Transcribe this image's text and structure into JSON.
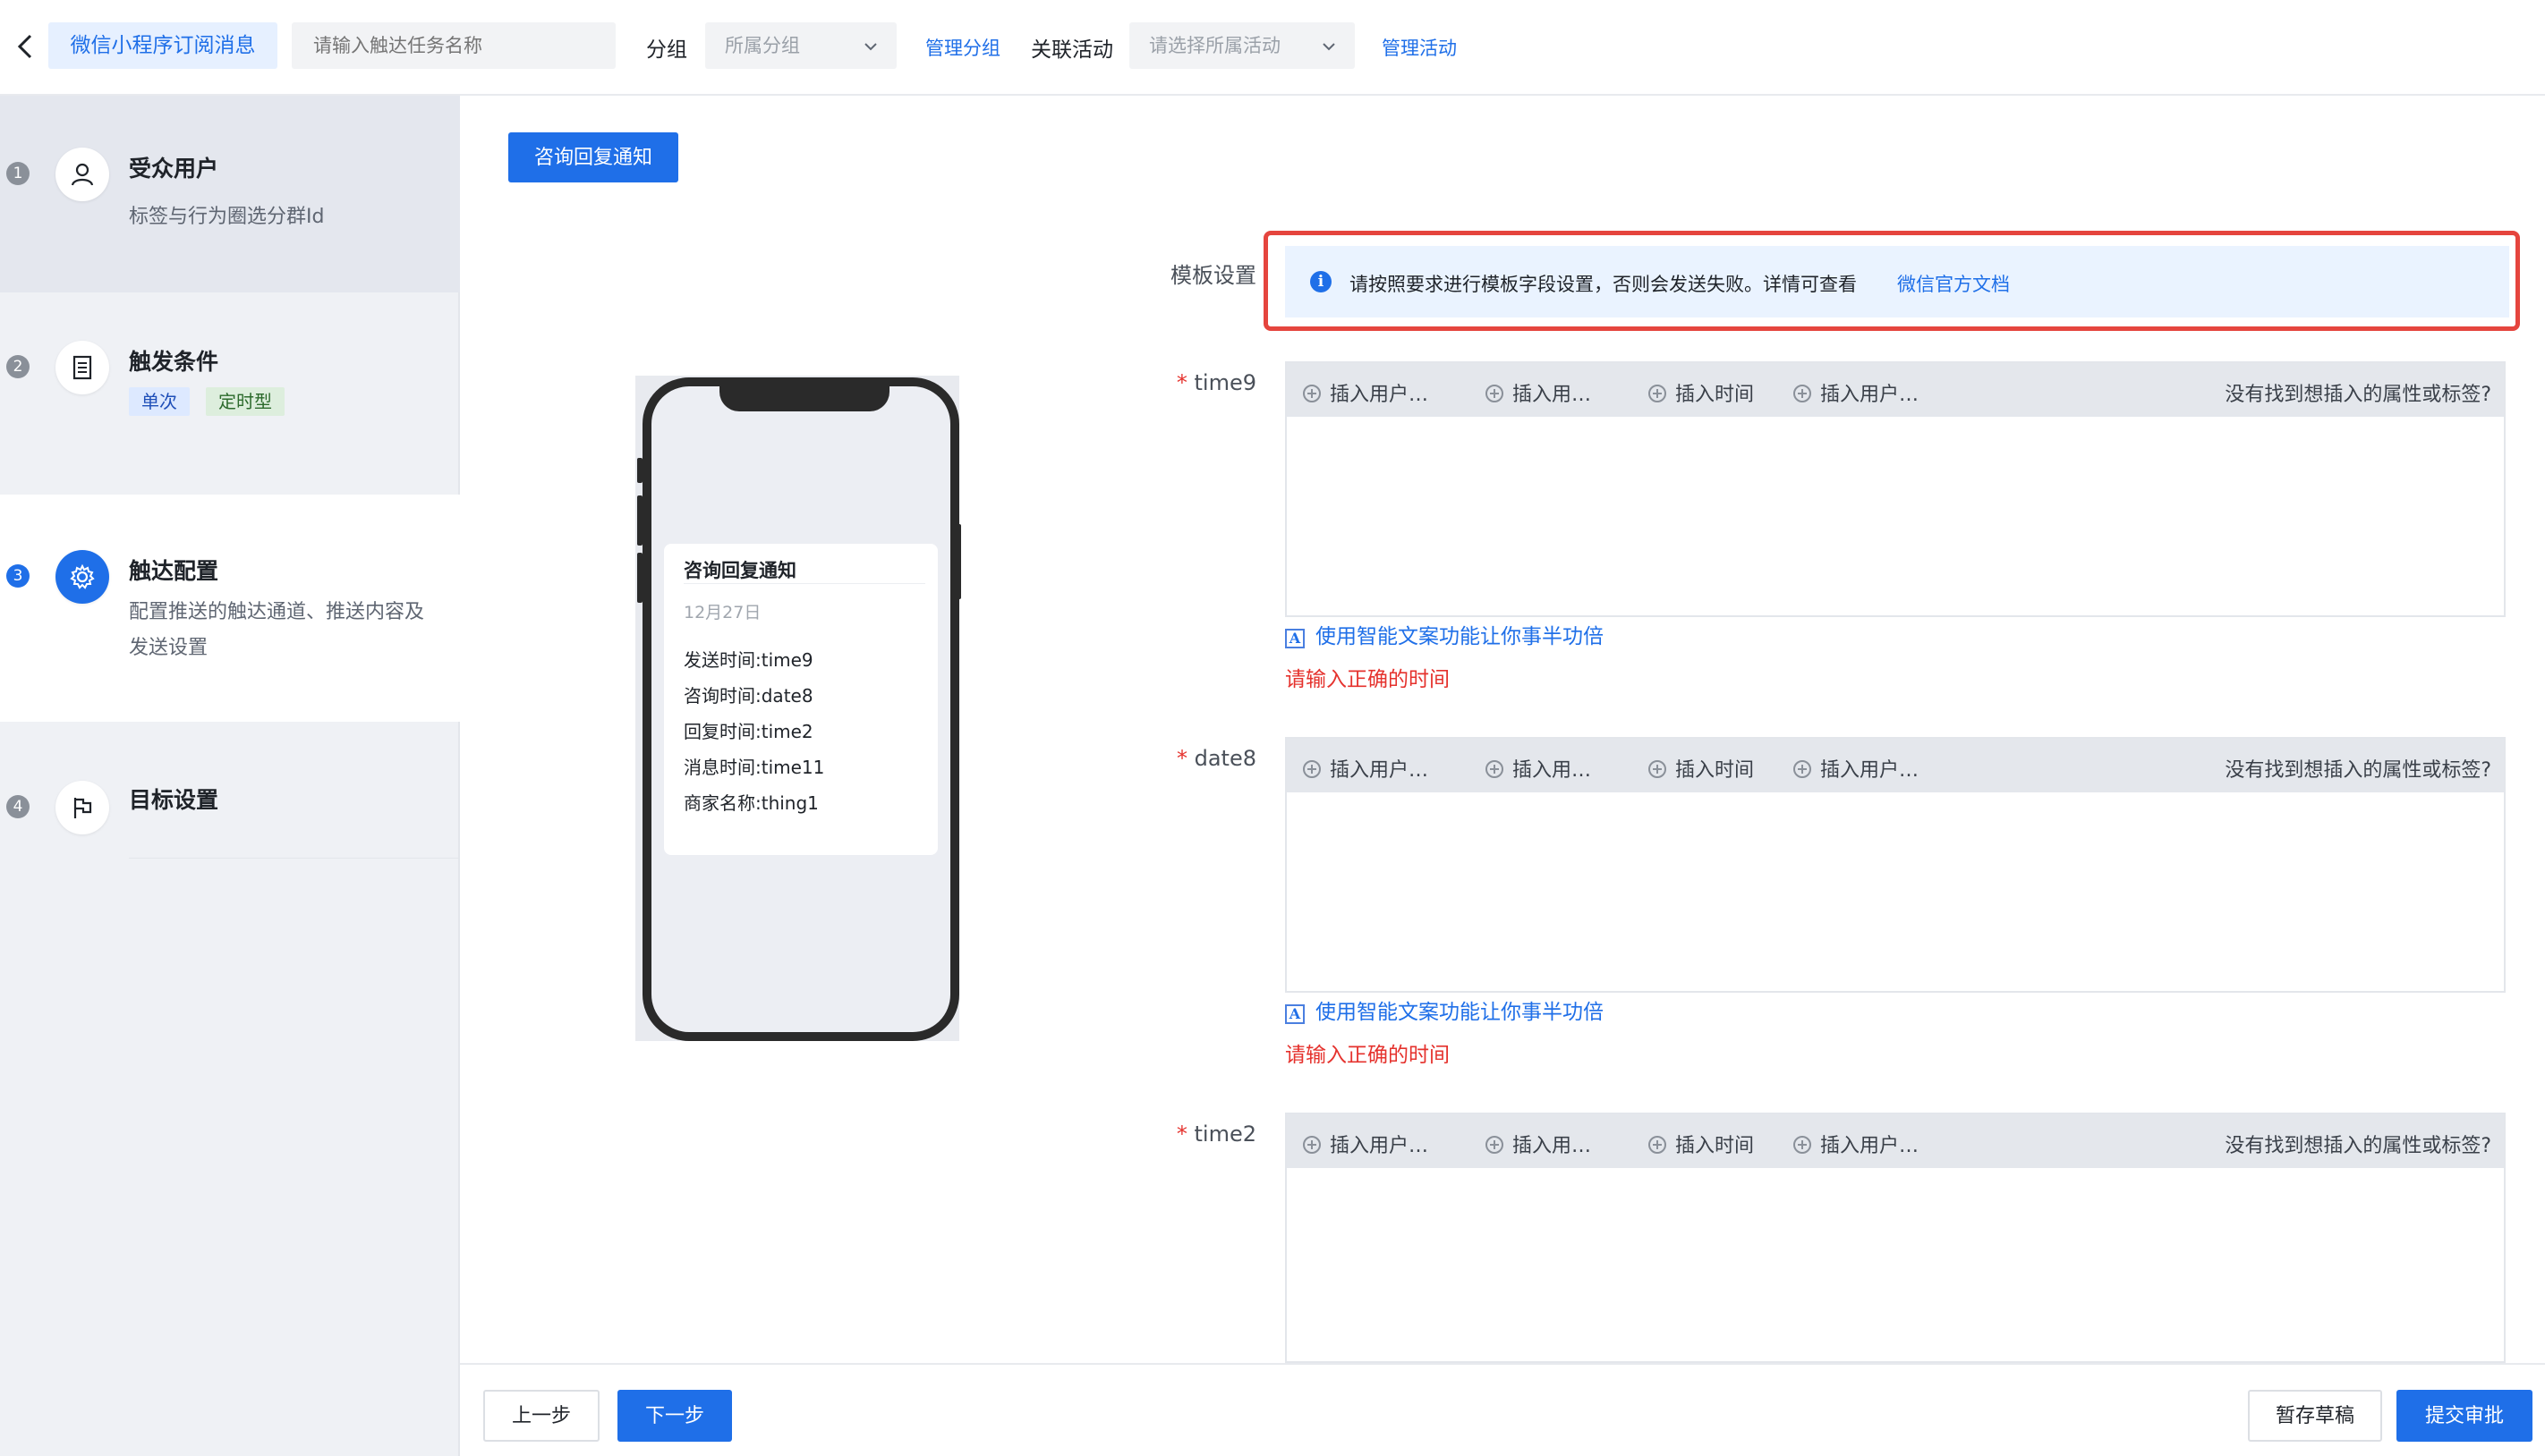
{
  "header": {
    "title_tab": "微信小程序订阅消息",
    "task_name_placeholder": "请输入触达任务名称",
    "group_label": "分组",
    "group_select": "所属分组",
    "manage_group": "管理分组",
    "activity_label": "关联活动",
    "activity_select": "请选择所属活动",
    "manage_activity": "管理活动"
  },
  "sidebar": {
    "steps": [
      {
        "num": "1",
        "title": "受众用户",
        "desc": "标签与行为圈选分群Id",
        "icon": "user-icon"
      },
      {
        "num": "2",
        "title": "触发条件",
        "tags": [
          "单次",
          "定时型"
        ],
        "icon": "document-icon"
      },
      {
        "num": "3",
        "title": "触达配置",
        "desc": "配置推送的触达通道、推送内容及发送设置",
        "icon": "gear-icon"
      },
      {
        "num": "4",
        "title": "目标设置",
        "icon": "flag-icon"
      }
    ]
  },
  "main": {
    "template_button": "咨询回复通知",
    "template_setting_label": "模板设置",
    "notice_text": "请按照要求进行模板字段设置，否则会发送失败。详情可查看",
    "notice_link": "微信官方文档",
    "phone": {
      "card_title": "咨询回复通知",
      "card_date": "12月27日",
      "rows": [
        "发送时间:time9",
        "咨询时间:date8",
        "回复时间:time2",
        "消息时间:time11",
        "商家名称:thing1"
      ]
    },
    "toolbar": {
      "items": [
        "插入用户…",
        "插入用…",
        "插入时间",
        "插入用户…"
      ],
      "right": "没有找到想插入的属性或标签?"
    },
    "fields": [
      {
        "label": "time9",
        "ai_link": "使用智能文案功能让你事半功倍",
        "error": "请输入正确的时间"
      },
      {
        "label": "date8",
        "ai_link": "使用智能文案功能让你事半功倍",
        "error": "请输入正确的时间"
      },
      {
        "label": "time2"
      }
    ],
    "required_mark": "*"
  },
  "footer": {
    "prev": "上一步",
    "next": "下一步",
    "save_draft": "暂存草稿",
    "submit": "提交审批"
  },
  "colors": {
    "primary": "#1f6fe8",
    "error": "#e5322d",
    "highlight_outline": "#e5453e"
  }
}
